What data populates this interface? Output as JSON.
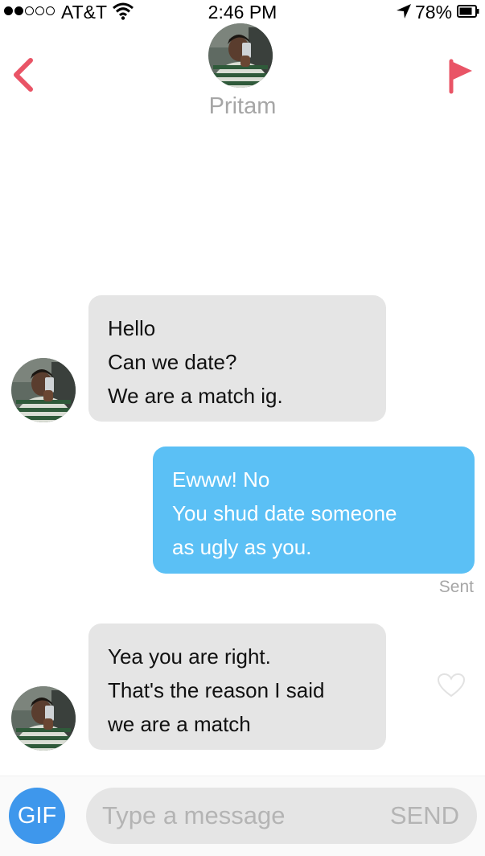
{
  "status_bar": {
    "carrier": "AT&T",
    "time": "2:46 PM",
    "battery": "78%",
    "signal_bars_filled": 2,
    "signal_bars_total": 5
  },
  "header": {
    "contact_name": "Pritam",
    "back_icon": "chevron-left-icon",
    "report_icon": "flag-icon",
    "accent_color": "#e95466"
  },
  "messages": [
    {
      "direction": "incoming",
      "lines": [
        "Hello",
        "Can we date?",
        "We are a match ig."
      ]
    },
    {
      "direction": "outgoing",
      "lines": [
        "Ewww! No",
        "You shud date someone",
        "as ugly as you."
      ],
      "status": "Sent"
    },
    {
      "direction": "incoming",
      "lines": [
        "Yea you are right.",
        "That's the reason I said",
        "we are a match"
      ]
    }
  ],
  "composer": {
    "gif_label": "GIF",
    "placeholder": "Type a message",
    "send_label": "SEND"
  },
  "colors": {
    "incoming_bubble": "#e5e5e5",
    "outgoing_bubble": "#5bc0f5",
    "gif_button": "#3e97ec"
  }
}
